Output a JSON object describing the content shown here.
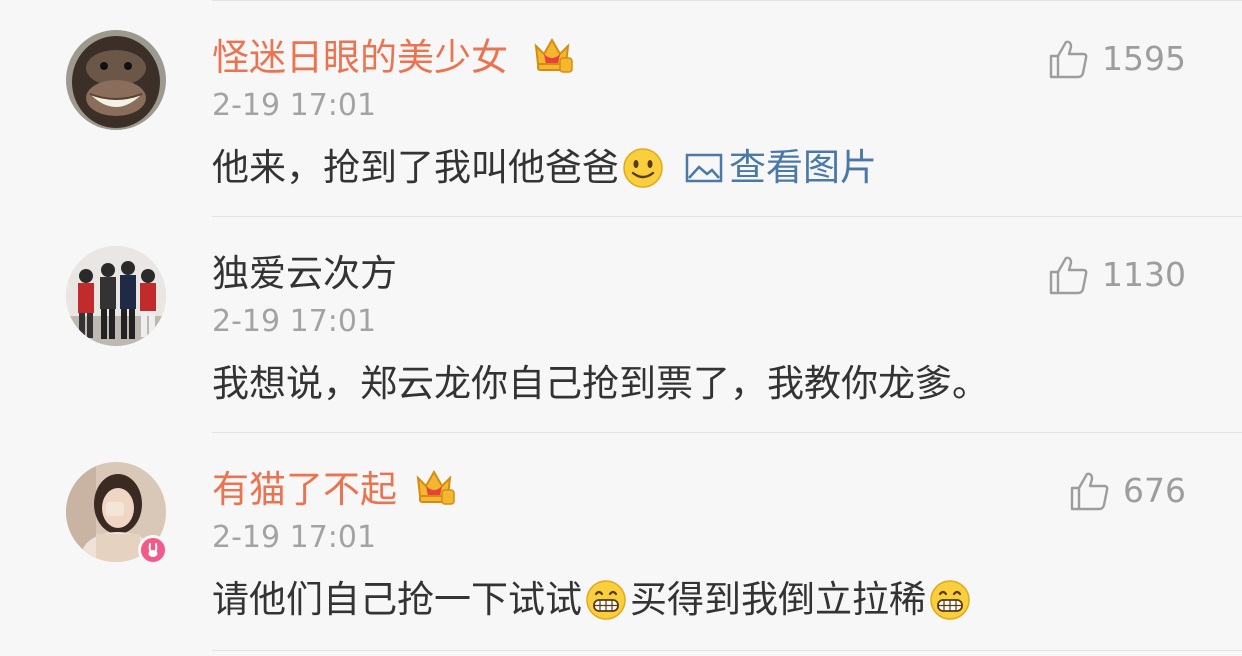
{
  "comments": [
    {
      "username": "怪迷日眼的美少女",
      "is_vip": true,
      "crown_icon": "vip-crown-icon",
      "time": "2-19 17:01",
      "text_before": "他来，抢到了我叫他爸爸",
      "emoji_1": "smile-emoji",
      "view_picture": "查看图片",
      "likes": "1595"
    },
    {
      "username": "独爱云次方",
      "is_vip": false,
      "time": "2-19 17:01",
      "text": "我想说，郑云龙你自己抢到票了，我教你龙爹。",
      "likes": "1130"
    },
    {
      "username": "有猫了不起",
      "is_vip": true,
      "crown_icon": "vip-crown-icon",
      "time": "2-19 17:01",
      "text_part1": "请他们自己抢一下试试",
      "emoji_1": "grin-emoji",
      "text_part2": "买得到我倒立拉稀",
      "emoji_2": "grin-emoji",
      "likes": "676"
    }
  ],
  "colors": {
    "background": "#f7f7f7",
    "vip_name": "#eb7350",
    "text": "#333333",
    "meta": "#a3a3a3",
    "link": "#4a79a8",
    "like": "#9d9d9d"
  }
}
